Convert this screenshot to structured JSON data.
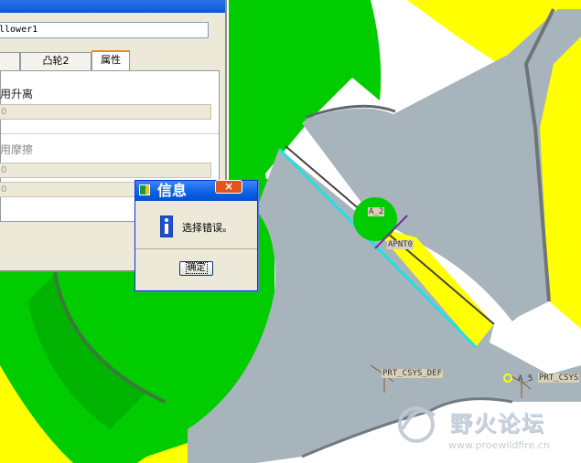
{
  "cad_view": {
    "datum_labels": {
      "a2": "A_2",
      "apnt0": "APNT0",
      "prt_csys_def": "PRT_CSYS_DEF",
      "a5": "A_5",
      "prt_csys_right": "PRT_CSYS"
    },
    "colors": {
      "green": "#00cc00",
      "yellow": "#ffff00",
      "gray": "#a8b4bc",
      "cyan": "#20e0e0"
    }
  },
  "properties_dialog": {
    "name_value": "llower1",
    "tabs": [
      "",
      "凸轮2",
      "属性"
    ],
    "active_tab": "属性",
    "section1_label": "用升离",
    "section1_field": "0",
    "section2_label": "用摩擦",
    "section2_field1": "0",
    "section2_field2": "0"
  },
  "message_box": {
    "title": "信息",
    "message": "选择错误。",
    "ok_label": "确定",
    "close_glyph": "×"
  },
  "watermark": {
    "site_name": "野火论坛",
    "url": "www.proewildfire.cn"
  }
}
